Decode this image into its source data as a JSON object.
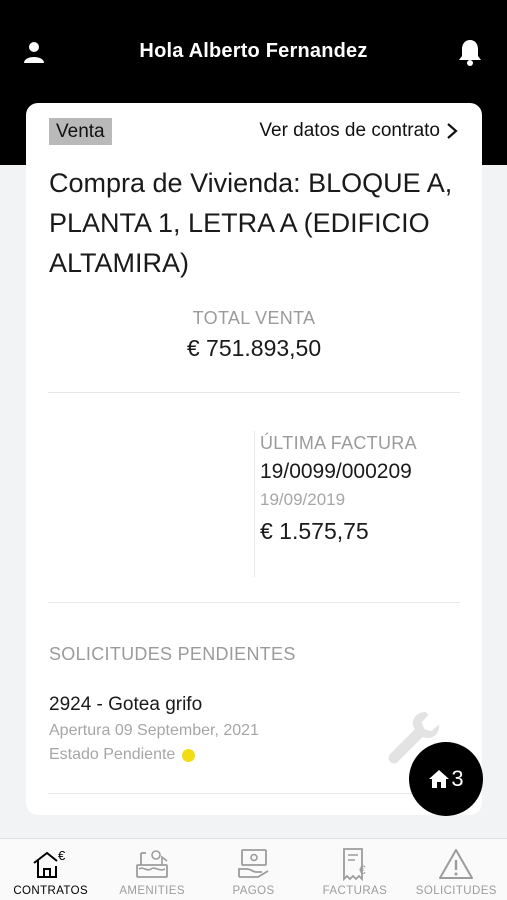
{
  "header": {
    "greeting": "Hola Alberto Fernandez",
    "user_icon": "user-icon",
    "notifications_icon": "bell-icon"
  },
  "contract": {
    "badge": "Venta",
    "view_contract_label": "Ver datos de contrato",
    "title": "Compra de Vivienda: BLOQUE A, PLANTA 1, LETRA A (EDIFICIO ALTAMIRA)",
    "total_label": "TOTAL VENTA",
    "total_value": "€ 751.893,50"
  },
  "last_invoice": {
    "label": "ÚLTIMA FACTURA",
    "number": "19/0099/000209",
    "date": "19/09/2019",
    "amount": "€ 1.575,75"
  },
  "requests": {
    "title": "SOLICITUDES PENDIENTES",
    "items": [
      {
        "name": "2924 - Gotea grifo",
        "opened": "Apertura 09 September, 2021",
        "status": "Estado Pendiente",
        "status_color": "#f2dc13",
        "icon": "wrench-icon"
      }
    ]
  },
  "fab": {
    "icon": "home-icon",
    "count": "3"
  },
  "tabbar": {
    "active": "contratos",
    "items": [
      {
        "label": "CONTRATOS",
        "icon": "house-euro-icon"
      },
      {
        "label": "AMENITIES",
        "icon": "amenities-icon"
      },
      {
        "label": "PAGOS",
        "icon": "payments-icon"
      },
      {
        "label": "FACTURAS",
        "icon": "invoice-icon"
      },
      {
        "label": "SOLICITUDES",
        "icon": "warning-icon"
      }
    ]
  },
  "colors": {
    "header_bg": "#000000",
    "page_bg": "#f1f3f4",
    "badge_bg": "#b9b9b9",
    "muted_text": "#9b9b9b",
    "active_tab": "#000000",
    "inactive_tab": "#9c9c9c"
  }
}
